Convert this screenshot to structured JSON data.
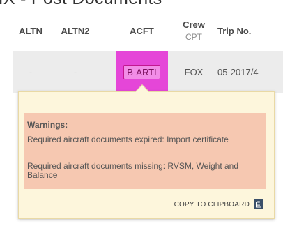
{
  "page": {
    "heading": "FIX - Post Documents"
  },
  "table": {
    "headers": {
      "altn": "ALTN",
      "altn2": "ALTN2",
      "acft": "ACFT",
      "crew": "Crew",
      "crew_sub": "CPT",
      "trip_no": "Trip No."
    },
    "row": {
      "altn": "-",
      "altn2": "-",
      "acft": "B-ARTI",
      "crew_cpt": "FOX",
      "trip_no": "05-2017/4"
    }
  },
  "popup": {
    "warnings_title": "Warnings:",
    "warnings": [
      "Required aircraft documents expired: Import certificate",
      "Required aircraft documents missing: RVSM, Weight and Balance"
    ],
    "copy_label": "COPY TO CLIPBOARD",
    "copy_icon": "clipboard-icon"
  },
  "colors": {
    "acft_highlight": "#e546d8",
    "warning_bg": "#f6c8b1",
    "popup_bg": "#fdf6dc"
  }
}
